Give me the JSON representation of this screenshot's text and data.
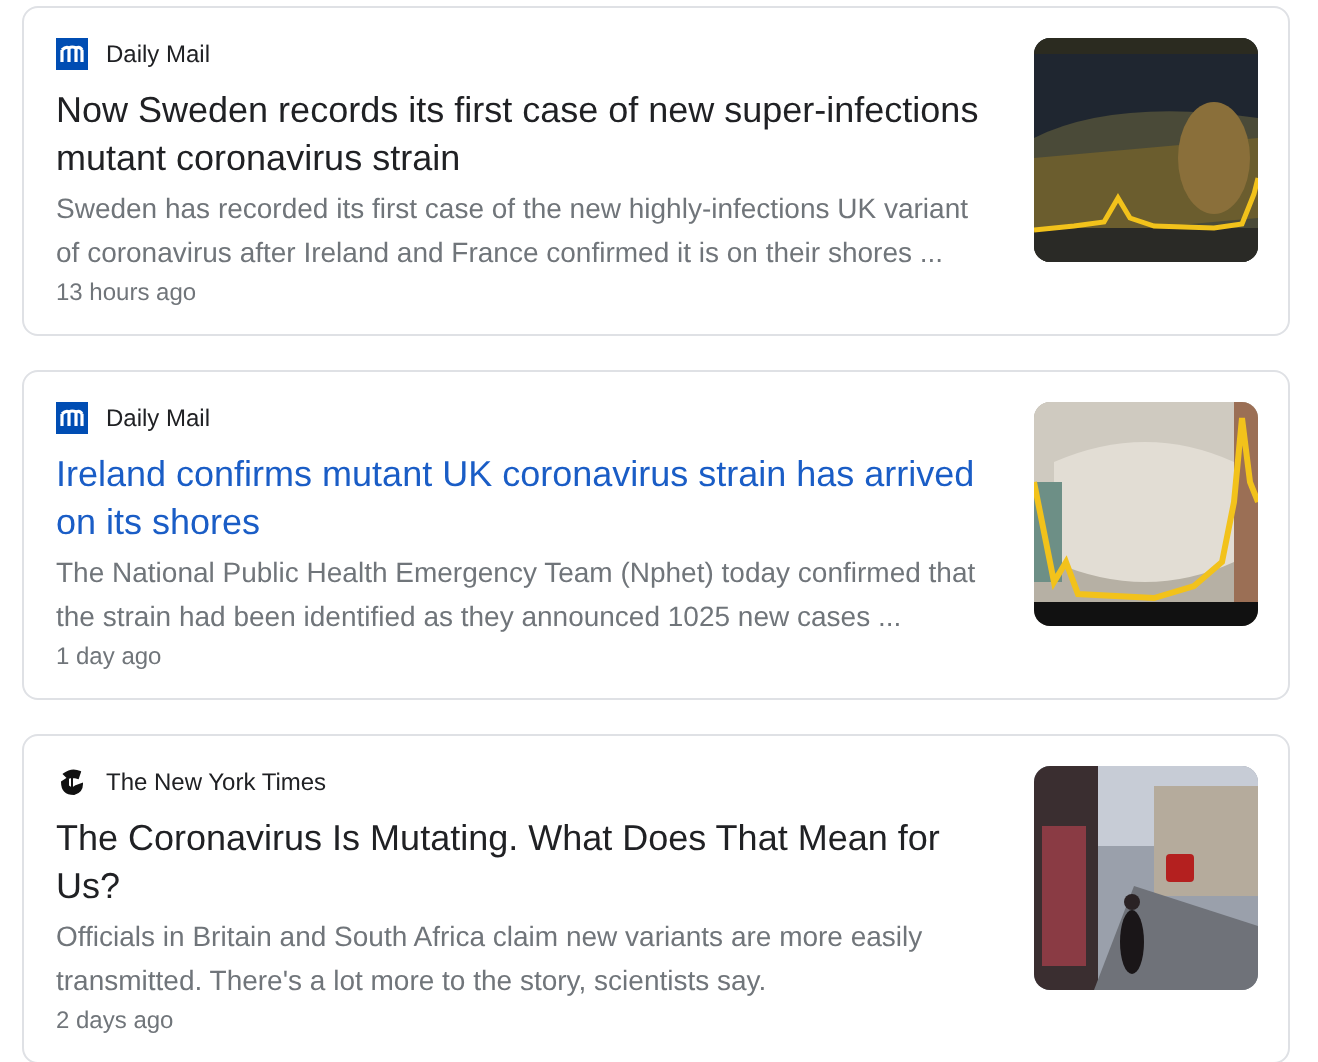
{
  "articles": [
    {
      "source": {
        "name": "Daily Mail",
        "kind": "square"
      },
      "title": "Now Sweden records its first case of new super-infections mutant coronavirus strain",
      "hovered": false,
      "snippet": "Sweden has recorded its first case of the new highly-infections UK variant of coronavirus after Ireland and France confirmed it is on their shores ...",
      "time": "13 hours ago"
    },
    {
      "source": {
        "name": "Daily Mail",
        "kind": "square"
      },
      "title": "Ireland confirms mutant UK coronavirus strain has arrived on its shores",
      "hovered": true,
      "snippet": "The National Public Health Emergency Team (Nphet) today confirmed that the strain had been identified as they announced 1025 new cases ...",
      "time": "1 day ago"
    },
    {
      "source": {
        "name": "The New York Times",
        "kind": "emblem"
      },
      "title": "The Coronavirus Is Mutating. What Does That Mean for Us?",
      "hovered": false,
      "snippet": "Officials in Britain and South Africa claim new variants are more easily transmitted. There's a lot more to the story, scientists say.",
      "time": "2 days ago"
    }
  ]
}
